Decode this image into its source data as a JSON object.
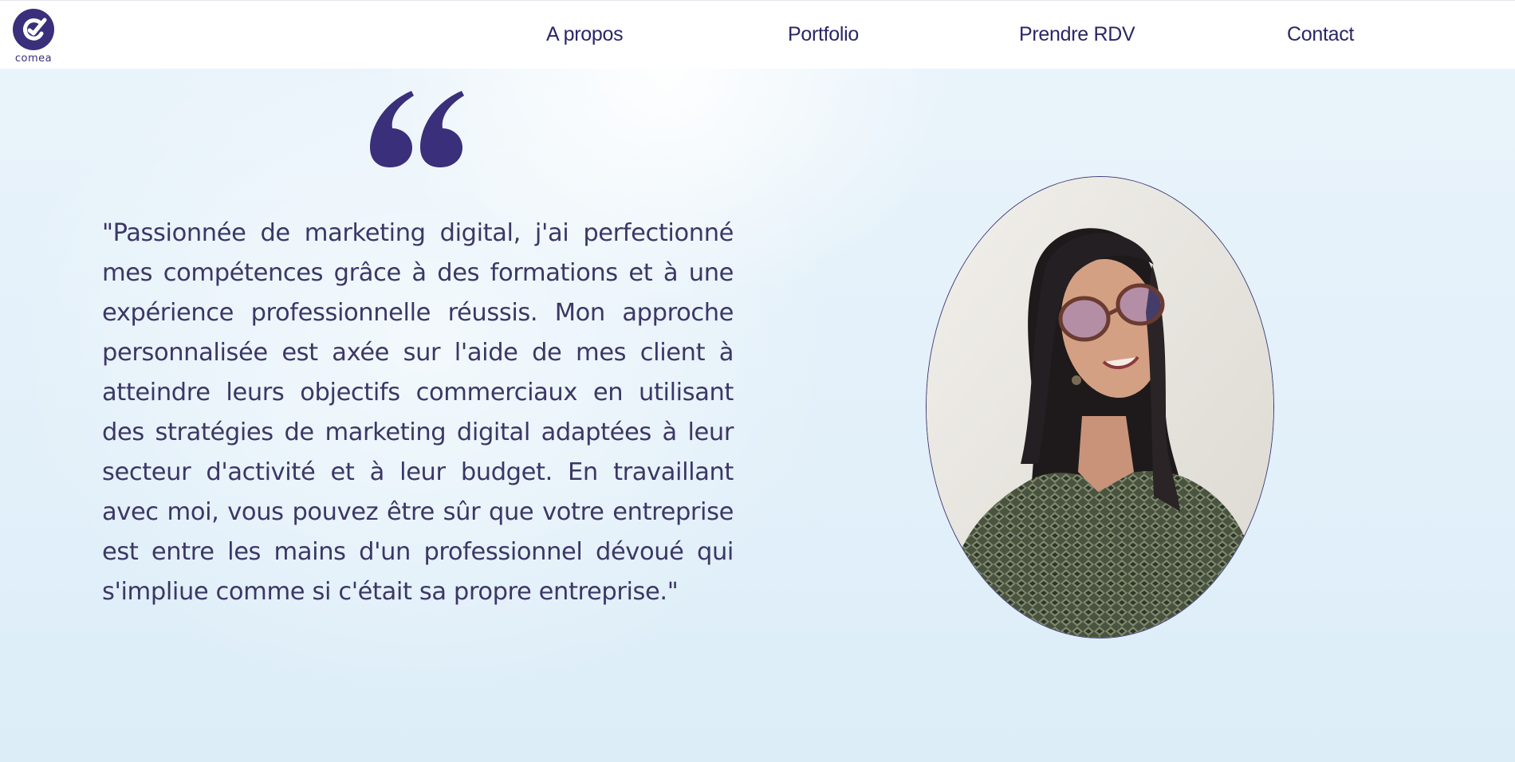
{
  "brand": {
    "name": "comea",
    "color": "#3a2f7a"
  },
  "nav": {
    "items": [
      {
        "label": "A propos"
      },
      {
        "label": "Portfolio"
      },
      {
        "label": "Prendre RDV"
      },
      {
        "label": "Contact"
      }
    ]
  },
  "testimonial": {
    "quote_icon": "quote-icon",
    "text": "\"Passionnée de marketing digital, j'ai perfectionné mes compétences grâce à des formations et à une expérience professionnelle réussis. Mon approche personnalisée est axée sur l'aide de mes client à atteindre leurs objectifs commerciaux en utilisant des stratégies de marketing digital adaptées à leur secteur d'activité et à leur budget. En travaillant avec moi, vous pouvez être sûr que votre entreprise est entre les mains d'un professionnel dévoué qui s'impliue comme si c'était sa propre entreprise.\""
  },
  "colors": {
    "accent": "#3a2f7a",
    "text": "#3c3766",
    "background": "#e2f0f9"
  }
}
